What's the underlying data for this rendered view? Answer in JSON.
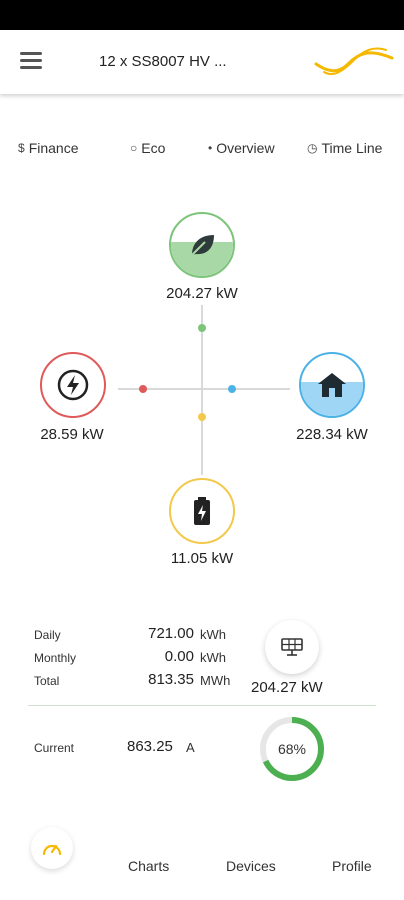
{
  "header": {
    "title": "12 x SS8007 HV ...",
    "logo_color": "#F5B800"
  },
  "tabs": [
    {
      "icon": "dollar-icon",
      "glyph": "$",
      "label": "Finance"
    },
    {
      "icon": "eco-icon",
      "glyph": "○",
      "label": "Eco"
    },
    {
      "icon": "overview-icon",
      "glyph": "•",
      "label": "Overview"
    },
    {
      "icon": "clock-icon",
      "glyph": "◷",
      "label": "Time Line"
    }
  ],
  "flow": {
    "eco": {
      "value": "204.27 kW",
      "color": "#7CC47A",
      "fill_level": 0.55
    },
    "grid": {
      "value": "28.59 kW",
      "color": "#E05A5A",
      "fill_level": 0
    },
    "home": {
      "value": "228.34 kW",
      "color": "#4CB2E6",
      "fill_level": 0.55
    },
    "battery": {
      "value": "11.05 kW",
      "color": "#F2C94C",
      "fill_level": 0
    }
  },
  "stats": {
    "daily": {
      "label": "Daily",
      "value": "721.00",
      "unit": "kWh"
    },
    "monthly": {
      "label": "Monthly",
      "value": "0.00",
      "unit": "kWh"
    },
    "total": {
      "label": "Total",
      "value": "813.35",
      "unit": "MWh"
    }
  },
  "solar": {
    "value": "204.27 kW"
  },
  "current": {
    "label": "Current",
    "value": "863.25",
    "unit": "A"
  },
  "gauge": {
    "percent_text": "68%",
    "percent": 68,
    "color": "#4CAF50",
    "track": "#e6e6e6"
  },
  "nav": {
    "home_color": "#F5B800",
    "items": [
      "Charts",
      "Devices",
      "Profile"
    ]
  }
}
